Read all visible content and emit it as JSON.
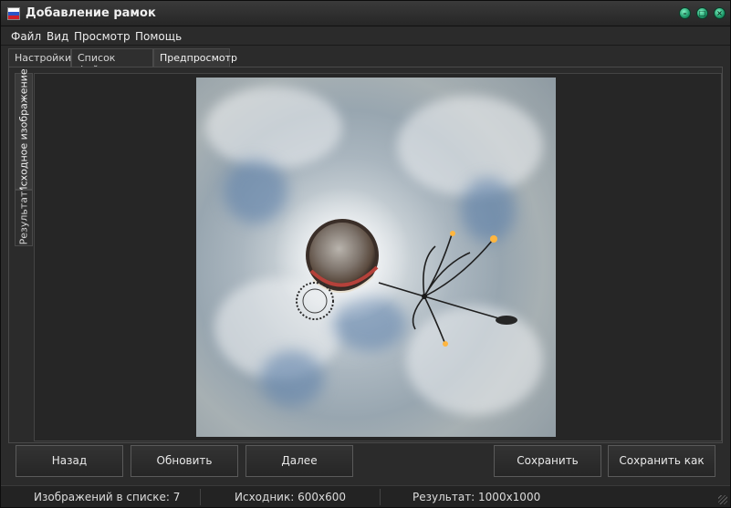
{
  "window": {
    "title": "Добавление рамок"
  },
  "menu": {
    "items": [
      "Файл",
      "Вид",
      "Просмотр",
      "Помощь"
    ]
  },
  "tabs": [
    {
      "label": "Настройки",
      "active": false
    },
    {
      "label": "Список файлов",
      "active": false
    },
    {
      "label": "Предпросмотр",
      "active": true
    }
  ],
  "preview_tabs": [
    {
      "label": "Исходное изображение",
      "active": true
    },
    {
      "label": "Результат",
      "active": false
    }
  ],
  "buttons": {
    "back": "Назад",
    "refresh": "Обновить",
    "next": "Далее",
    "save": "Сохранить",
    "save_as": "Сохранить как"
  },
  "status": {
    "images_count": "Изображений в списке: 7",
    "source": "Исходник: 600x600",
    "result": "Результат: 1000x1000"
  },
  "colors": {
    "background": "#2b2b2b",
    "title_button": "#1e9a6a",
    "flag": [
      "#ffffff",
      "#2a55c8",
      "#d0202a"
    ]
  }
}
